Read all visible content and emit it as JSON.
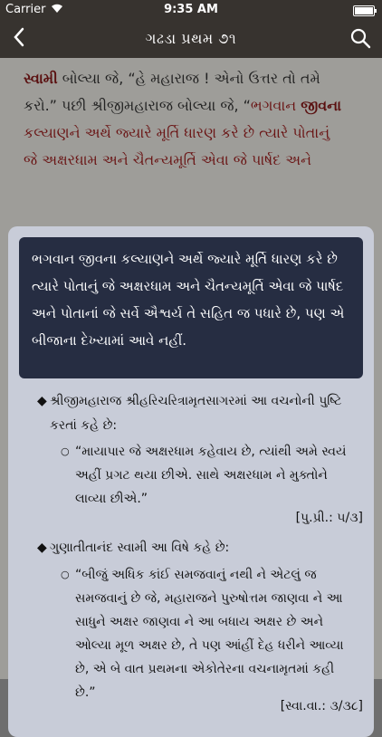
{
  "status": {
    "carrier": "Carrier",
    "time": "9:35 AM"
  },
  "nav": {
    "title": "ગઢડા પ્રથમ ૭૧",
    "back_icon": "chevron-left-icon",
    "search_icon": "search-icon"
  },
  "paragraph": {
    "l1a": "સ્વામી",
    "l1b": " બોલ્યા જે, “હે મહારાજ ! એનો ઉત્તર તો તમે",
    "l2a": "કરો.” પછી શ્રીજીમહારાજ બોલ્યા જે, “",
    "l2b": "ભગવાન ",
    "l2c": "જીવના",
    "l3": "કલ્યાણને અર્થે જ્યારે મૂર્તિ ધારણ કરે છે ત્યારે પોતાનું",
    "l4": "જે અક્ષરધામ અને ચૈતન્યમૂર્તિ એવા જે પાર્ષદ અને"
  },
  "popup": {
    "highlight": "ભગવાન જીવના કલ્યાણને અર્થે જ્યારે મૂર્તિ ધારણ કરે છે ત્યારે પોતાનું જે અક્ષરધામ અને ચૈતન્યમૂર્તિ એવા જે પાર્ષદ અને પોતાનાં જે સર્વે ઐશ્વર્ય તે સહિત જ પધારે છે, પણ એ બીજાના દેખ્યામાં આવે નહીં.",
    "note1": "શ્રીજીમહારાજ શ્રીહરિચરિત્રામૃતસાગરમાં આ વચનોની પુષ્ટિ કરતાં કહે છે:",
    "quote1": "“માયાપાર જે અક્ષરધામ કહેવાય છે, ત્યાંથી અમે સ્વયં અહીં પ્રગટ થયા છીએ. સાથે અક્ષરધામ ને મુક્તોને લાવ્યા છીએ.”",
    "ref1": "[પુ.પ્રી.: ૫/૩]",
    "note2": "ગુણાતીતાનંદ સ્વામી આ વિષે કહે છે:",
    "quote2": "“બીજું અધિક કાંઈ સમજવાનું નથી ને એટલું જ સમજવાનું છે જે, મહારાજને પુરુષોત્તમ જાણવા ને આ સાધુને અક્ષર જાણવા ને આ બધાય અક્ષર છે અને ઓલ્યા મૂળ અક્ષર છે, તે પણ આંહીં દેહ ધરીને આવ્યા છે, એ બે વાત પ્રથમના એકોતેરના વચનામૃતમાં કહી છે.”",
    "ref2": "[સ્વા.વા.: ૩/૩૮]"
  }
}
